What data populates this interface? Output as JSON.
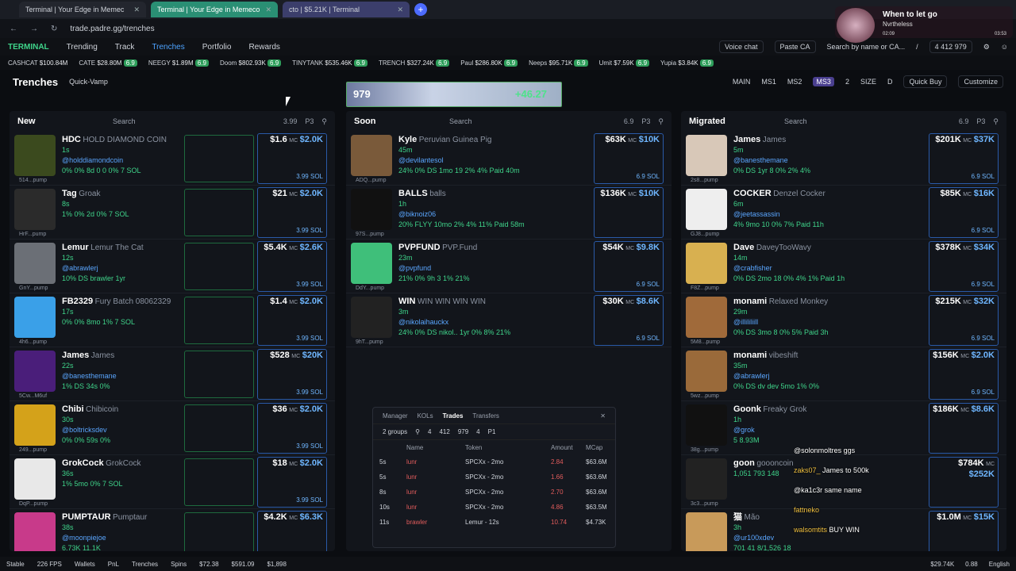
{
  "browser": {
    "tabs": [
      "Terminal | Your Edge in Memec",
      "Terminal | Your Edge in Memeco",
      "cto | $5.21K | Terminal"
    ],
    "new_tab": "+",
    "url": "trade.padre.gg/trenches"
  },
  "nav": {
    "logo": "TERMINAL",
    "items": [
      "Trending",
      "Track",
      "Trenches",
      "Portfolio",
      "Rewards"
    ],
    "active": "Trenches",
    "voice": "Voice chat",
    "paste": "Paste CA",
    "search_placeholder": "Search by name or CA...",
    "slash": "/",
    "wallet": [
      "4",
      "412",
      "979"
    ]
  },
  "ticker": [
    {
      "name": "CASHCAT",
      "v": "$100.84M"
    },
    {
      "name": "CATE",
      "v": "$28.80M",
      "b": "6.9"
    },
    {
      "name": "NEEGY",
      "v": "$1.89M",
      "b": "6.9"
    },
    {
      "name": "Doom",
      "v": "$802.93K",
      "b": "6.9"
    },
    {
      "name": "TINYTANK",
      "v": "$535.46K",
      "b": "6.9"
    },
    {
      "name": "TRENCH",
      "v": "$327.24K",
      "b": "6.9"
    },
    {
      "name": "Paul",
      "v": "$286.80K",
      "b": "6.9"
    },
    {
      "name": "Neeps",
      "v": "$95.71K",
      "b": "6.9"
    },
    {
      "name": "Umit",
      "v": "$7.59K",
      "b": "6.9"
    },
    {
      "name": "Yupia",
      "v": "$3.84K",
      "b": "6.9"
    }
  ],
  "header": {
    "title": "Trenches",
    "quick_vamp": "Quick-Vamp",
    "banner_left": "979",
    "banner_right": "+46.27",
    "modes": [
      "MAIN",
      "MS1",
      "MS2",
      "MS3",
      "2",
      "SIZE",
      "D"
    ],
    "quick_buy": "Quick Buy",
    "customize": "Customize"
  },
  "columns": [
    {
      "title": "New",
      "search": "Search",
      "amt": "3.99",
      "p": "P3",
      "cards": [
        {
          "sym": "HDC",
          "name": "HOLD DIAMOND COIN",
          "age": "1s",
          "handle": "@holddiamondcoin",
          "stats": "0% 0% 8d 0 0 0% 7 SOL",
          "price": "$1.6",
          "mc": "$2.0K",
          "sol": "3.99 SOL",
          "ava": "514...pump",
          "color": "#3b4a1e"
        },
        {
          "sym": "Tag",
          "name": "Groak",
          "age": "8s",
          "handle": "",
          "stats": "1% 0% 2d 0% 7 SOL",
          "price": "$21",
          "mc": "$2.0K",
          "sol": "3.99 SOL",
          "ava": "HrF...pump",
          "color": "#2b2b2b"
        },
        {
          "sym": "Lemur",
          "name": "Lemur The Cat",
          "age": "12s",
          "handle": "@abrawlerj",
          "stats": "10% DS brawler 1yr",
          "price": "$5.4K",
          "mc": "$2.6K",
          "sol": "3.99 SOL",
          "ava": "GnY...pump",
          "color": "#6b6f76"
        },
        {
          "sym": "FB2329",
          "name": "Fury Batch 08062329",
          "age": "17s",
          "handle": "",
          "stats": "0% 0% 8mo 1% 7 SOL",
          "price": "$1.4",
          "mc": "$2.0K",
          "sol": "3.99 SOL",
          "ava": "4h6...pump",
          "color": "#3aa0e8"
        },
        {
          "sym": "James",
          "name": "James",
          "age": "22s",
          "handle": "@banesthemane",
          "stats": "1% DS 34s 0%",
          "price": "$528",
          "mc": "$20K",
          "sol": "3.99 SOL",
          "ava": "5Cw...M6uf",
          "color": "#4a1e7a"
        },
        {
          "sym": "Chibi",
          "name": "Chibicoin",
          "age": "30s",
          "handle": "@boltricksdev",
          "stats": "0% 0% 59s 0%",
          "price": "$36",
          "mc": "$2.0K",
          "sol": "3.99 SOL",
          "ava": "249...pump",
          "color": "#d4a21a"
        },
        {
          "sym": "GrokCock",
          "name": "GrokCock",
          "age": "36s",
          "handle": "",
          "stats": "1% 5mo 0% 7 SOL",
          "price": "$18",
          "mc": "$2.0K",
          "sol": "3.99 SOL",
          "ava": "DqP...pump",
          "color": "#e8e8e8"
        },
        {
          "sym": "PUMPTAUR",
          "name": "Pumptaur",
          "age": "38s",
          "handle": "@moonpiejoe",
          "stats": "6.73K 11.1K",
          "price": "$4.2K",
          "mc": "$6.3K",
          "sol": "",
          "ava": "",
          "color": "#c83a8a"
        }
      ]
    },
    {
      "title": "Soon",
      "search": "Search",
      "amt": "6.9",
      "p": "P3",
      "cards": [
        {
          "sym": "Kyle",
          "name": "Peruvian Guinea Pig",
          "age": "45m",
          "handle": "@devilantesol",
          "stats": "24% 0% DS 1mo 19 2% 4% Paid 40m",
          "price": "$63K",
          "mc": "$10K",
          "sol": "6.9 SOL",
          "ava": "ADQ...pump",
          "color": "#7a5a3a"
        },
        {
          "sym": "BALLS",
          "name": "balls",
          "age": "1h",
          "handle": "@biknoiz06",
          "stats": "20% FLYY 10mo 2% 4% 11% Paid 58m",
          "price": "$136K",
          "mc": "$10K",
          "sol": "",
          "ava": "97S...pump",
          "color": "#111"
        },
        {
          "sym": "PVPFUND",
          "name": "PVP.Fund",
          "age": "23m",
          "handle": "@pvpfund",
          "stats": "21% 0% 9h 3 1% 21%",
          "price": "$54K",
          "mc": "$9.8K",
          "sol": "6.9 SOL",
          "ava": "DdY...pump",
          "color": "#3fbf7a"
        },
        {
          "sym": "WIN",
          "name": "WIN WIN WIN WIN",
          "age": "3m",
          "handle": "@nikolaihauckx",
          "stats": "24% 0% DS nikol.. 1yr 0% 8% 21%",
          "price": "$30K",
          "mc": "$8.6K",
          "sol": "6.9 SOL",
          "ava": "9hT...pump",
          "color": "#222"
        }
      ]
    },
    {
      "title": "Migrated",
      "search": "Search",
      "amt": "6.9",
      "p": "P3",
      "cards": [
        {
          "sym": "James",
          "name": "James",
          "age": "5m",
          "handle": "@banesthemane",
          "stats": "0% DS 1yr 8 0% 2% 4%",
          "price": "$201K",
          "mc": "$37K",
          "sol": "6.9 SOL",
          "ava": "2s8...pump",
          "color": "#d8c8b8"
        },
        {
          "sym": "COCKER",
          "name": "Denzel Cocker",
          "age": "6m",
          "handle": "@jeetassassin",
          "stats": "4% 9mo 10 0% 7% Paid 11h",
          "price": "$85K",
          "mc": "$16K",
          "sol": "6.9 SOL",
          "ava": "GJ8...pump",
          "color": "#eee"
        },
        {
          "sym": "Dave",
          "name": "DaveyTooWavy",
          "age": "14m",
          "handle": "@crabfisher",
          "stats": "0% DS 2mo 18 0% 4% 1% Paid 1h",
          "price": "$378K",
          "mc": "$34K",
          "sol": "6.9 SOL",
          "ava": "F8Z...pump",
          "color": "#d8b050"
        },
        {
          "sym": "monami",
          "name": "Relaxed Monkey",
          "age": "29m",
          "handle": "@illililiill",
          "stats": "0% DS 3mo 8 0% 5% Paid 3h",
          "price": "$215K",
          "mc": "$32K",
          "sol": "6.9 SOL",
          "ava": "5M8...pump",
          "color": "#a06a3a"
        },
        {
          "sym": "monami",
          "name": "vibeshift",
          "age": "35m",
          "handle": "@abrawlerj",
          "stats": "0% DS dv dev 5mo 1% 0%",
          "price": "$156K",
          "mc": "$2.0K",
          "sol": "6.9 SOL",
          "ava": "5wz...pump",
          "color": "#9a6a3a"
        },
        {
          "sym": "Goonk",
          "name": "Freaky Grok",
          "age": "1h",
          "handle": "@grok",
          "stats": "5 8.93M",
          "price": "$186K",
          "mc": "$8.6K",
          "sol": "",
          "ava": "38g...pump",
          "color": "#111"
        },
        {
          "sym": "goon",
          "name": "goooncoin",
          "age": "",
          "handle": "",
          "stats": "1,051 793 148",
          "price": "$784K",
          "mc": "$252K",
          "sol": "",
          "ava": "3c3...pump",
          "color": "#222"
        },
        {
          "sym": "猫",
          "name": "Mão",
          "age": "3h",
          "handle": "@ur100xdev",
          "stats": "701 41 8/1,526 18",
          "price": "$1.0M",
          "mc": "$15K",
          "sol": "",
          "ava": "",
          "color": "#c89a5a"
        }
      ]
    }
  ],
  "panel": {
    "tabs": [
      "Manager",
      "KOLs",
      "Trades",
      "Transfers"
    ],
    "active": "Trades",
    "groups": "2 groups",
    "ctrl": [
      "4",
      "412",
      "979",
      "4",
      "P1"
    ],
    "headers": [
      "Name",
      "Token",
      "Amount",
      "MCap"
    ],
    "rows": [
      {
        "t": "5s",
        "n": "lunr",
        "tok": "SPCXx - 2mo",
        "amt": "2.84",
        "mc": "$63.6M"
      },
      {
        "t": "5s",
        "n": "lunr",
        "tok": "SPCXx - 2mo",
        "amt": "1.66",
        "mc": "$63.6M"
      },
      {
        "t": "8s",
        "n": "lunr",
        "tok": "SPCXx - 2mo",
        "amt": "2.70",
        "mc": "$63.6M"
      },
      {
        "t": "10s",
        "n": "lunr",
        "tok": "SPCXx - 2mo",
        "amt": "4.86",
        "mc": "$63.5M"
      },
      {
        "t": "11s",
        "n": "brawler",
        "tok": "Lemur - 12s",
        "amt": "10.74",
        "mc": "$4.73K"
      }
    ]
  },
  "status": {
    "left": [
      "Stable",
      "226 FPS",
      "Wallets",
      "PnL",
      "Trenches",
      "Spins"
    ],
    "prices": [
      "$72.38",
      "$591.09",
      "$1,898"
    ],
    "right": [
      "$29.74K",
      "0.88",
      "English"
    ]
  },
  "stream": {
    "title": "When to let go",
    "sub": "Nvrtheless",
    "t0": "02:09",
    "t1": "03:53"
  },
  "chat": [
    {
      "u": "",
      "m": "@solonmoltres ggs"
    },
    {
      "u": "zaks07_",
      "m": "James to 500k"
    },
    {
      "u": "",
      "m": "@ka1c3r same name"
    },
    {
      "u": "fattneko",
      "m": ""
    },
    {
      "u": "walsomtits",
      "m": "BUY WIN"
    }
  ]
}
